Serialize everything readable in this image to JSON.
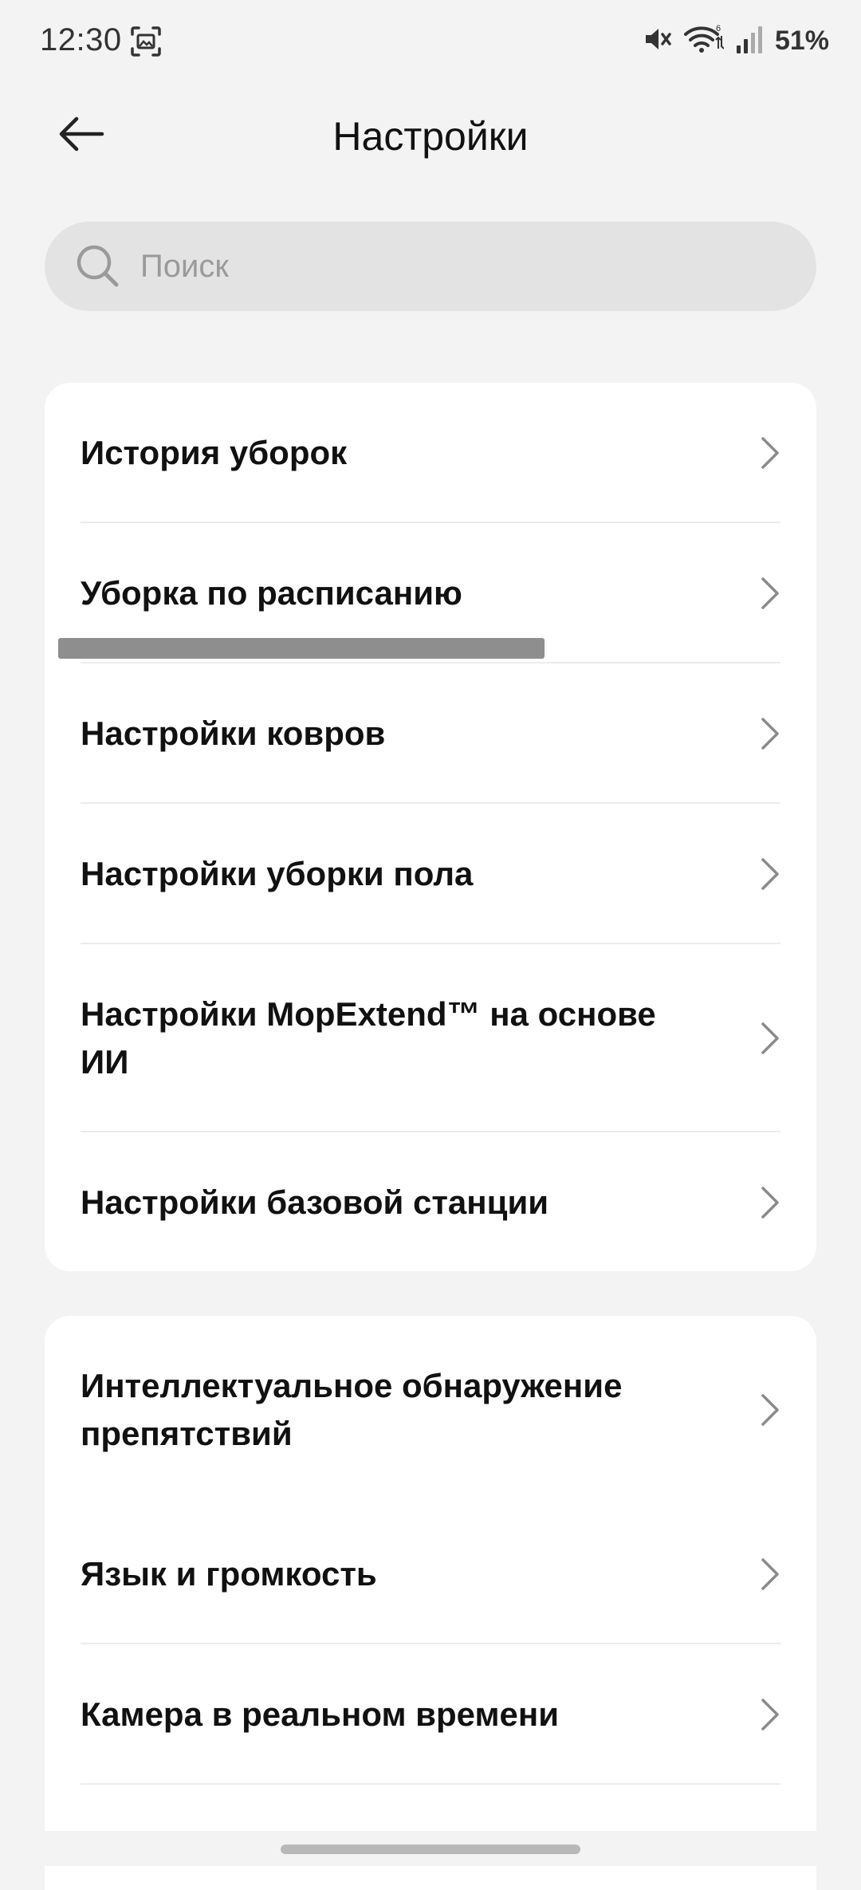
{
  "status_bar": {
    "time": "12:30",
    "battery": "51%",
    "icons": [
      "screenshot-icon",
      "mute-icon",
      "wifi-icon",
      "signal-icon"
    ]
  },
  "header": {
    "title": "Настройки",
    "back_icon": "arrow-left-icon"
  },
  "search": {
    "placeholder": "Поиск",
    "value": ""
  },
  "groups": [
    {
      "items": [
        {
          "label": "История уборок"
        },
        {
          "label": "Уборка по расписанию"
        },
        {
          "label": "Настройки ковров"
        },
        {
          "label": "Настройки уборки пола"
        },
        {
          "label": "Настройки MopExtend™ на основе ИИ"
        },
        {
          "label": "Настройки базовой станции"
        }
      ]
    },
    {
      "items": [
        {
          "label": "Интеллектуальное обнаружение препятствий"
        },
        {
          "label": "Язык и громкость"
        },
        {
          "label": "Камера в реальном времени"
        }
      ]
    }
  ],
  "colors": {
    "background": "#f3f3f3",
    "card": "#ffffff",
    "search_bg": "#e3e3e3",
    "text": "#111111",
    "chevron": "#8a8a8a"
  }
}
